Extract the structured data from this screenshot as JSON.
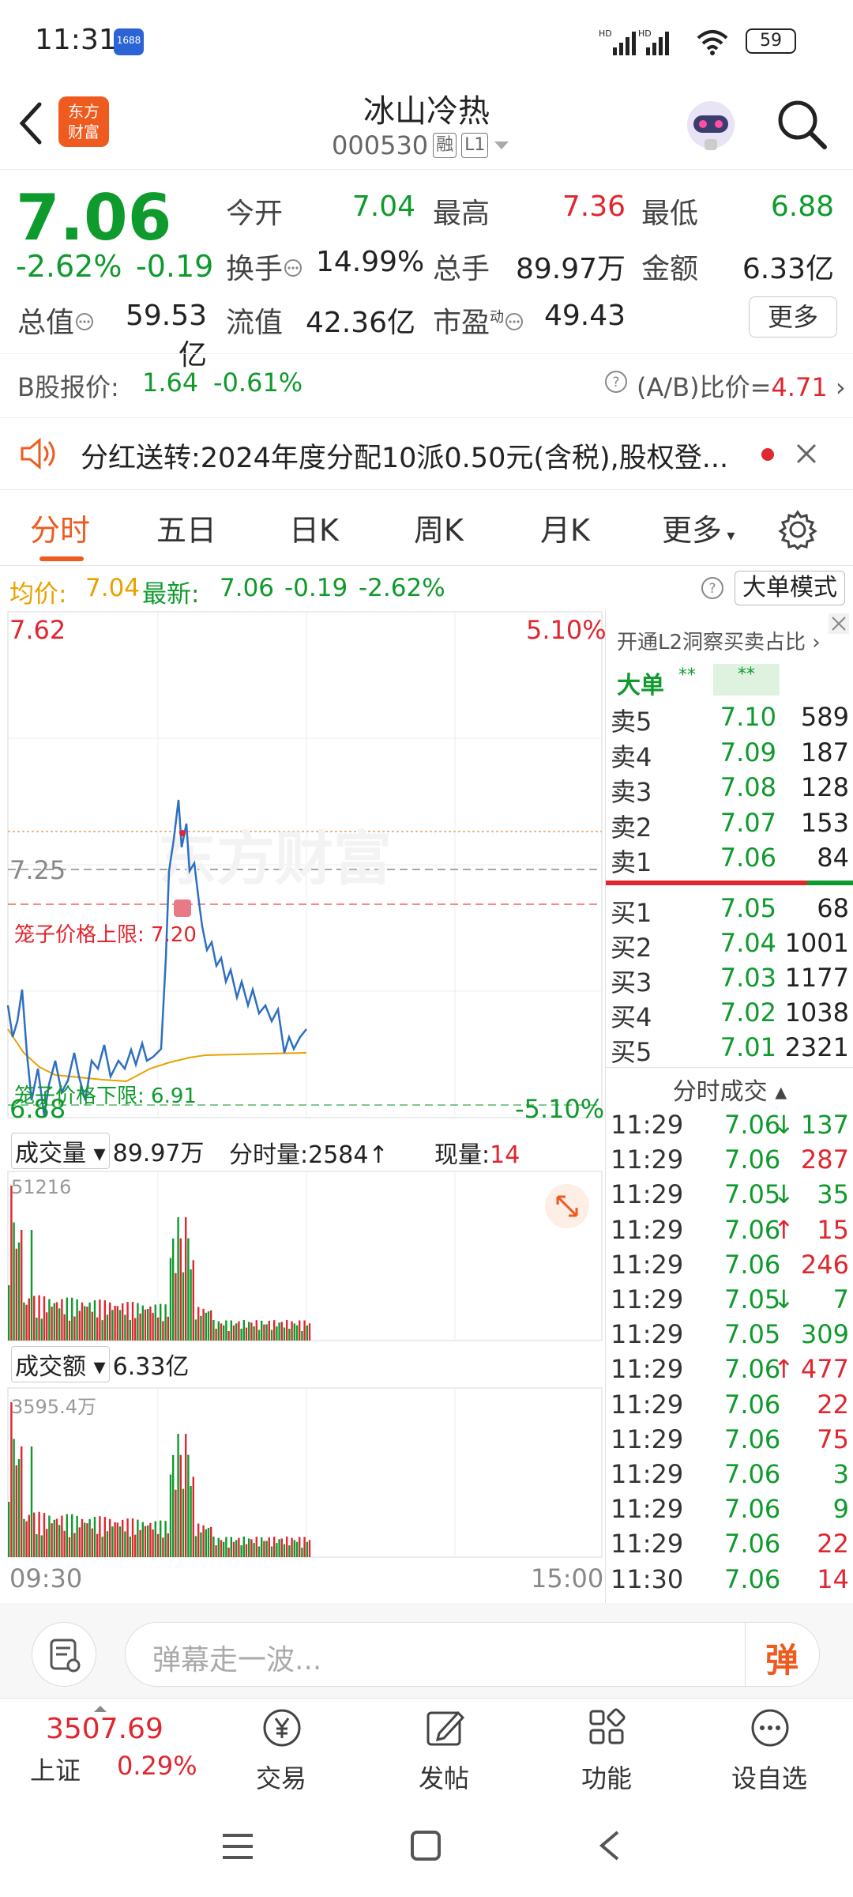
{
  "status_bar": {
    "time": "11:31",
    "badge": "1688",
    "battery": "59"
  },
  "header": {
    "logo_line1": "东方",
    "logo_line2": "财富",
    "title": "冰山冷热",
    "code": "000530",
    "tag_margin": "融",
    "tag_level": "L1"
  },
  "quote": {
    "price": "7.06",
    "change_pct": "-2.62%",
    "change": "-0.19",
    "open_label": "今开",
    "open": "7.04",
    "high_label": "最高",
    "high": "7.36",
    "low_label": "最低",
    "low": "6.88",
    "turnover_label": "换手",
    "turnover": "14.99%",
    "volume_label": "总手",
    "volume": "89.97万",
    "amount_label": "金额",
    "amount": "6.33亿",
    "mktcap_label": "总值",
    "mktcap": "59.53亿",
    "float_label": "流值",
    "float": "42.36亿",
    "pe_label": "市盈",
    "pe_sup": "动",
    "pe": "49.43",
    "more_button": "更多",
    "b_label": "B股报价:",
    "b_price": "1.64",
    "b_change": "-0.61%",
    "ab_label": "(A/B)比价=",
    "ab_value": "4.71"
  },
  "notice": {
    "text": "分红送转:2024年度分配10派0.50元(含税),股权登..."
  },
  "tabs": [
    "分时",
    "五日",
    "日K",
    "周K",
    "月K",
    "更多"
  ],
  "avg_bar": {
    "avg_label": "均价:",
    "avg": "7.04",
    "latest_label": "最新:",
    "latest": "7.06",
    "chg": "-0.19",
    "pct": "-2.62%",
    "mode_button": "大单模式"
  },
  "chart": {
    "top_price": "7.62",
    "top_pct": "5.10%",
    "bottom_price": "6.88",
    "bottom_pct": "-5.10%",
    "ref_price": "7.25",
    "upper_limit": "笼子价格上限: 7.20",
    "lower_limit": "笼子价格下限: 6.91",
    "watermark": "东方财富",
    "vol_label": "成交量",
    "vol_total": "89.97万",
    "tick_vol_label": "分时量:",
    "tick_vol": "2584",
    "cur_vol_label": "现量:",
    "cur_vol": "14",
    "vol_max": "51216",
    "amt_label": "成交额",
    "amt_total": "6.33亿",
    "amt_max": "3595.4万",
    "time_start": "09:30",
    "time_end": "15:00"
  },
  "order_book": {
    "l2_link": "开通L2洞察买卖占比",
    "big_label": "大单",
    "big_a": "**",
    "big_b": "**",
    "asks": [
      {
        "label": "卖5",
        "price": "7.10",
        "vol": "589"
      },
      {
        "label": "卖4",
        "price": "7.09",
        "vol": "187"
      },
      {
        "label": "卖3",
        "price": "7.08",
        "vol": "128"
      },
      {
        "label": "卖2",
        "price": "7.07",
        "vol": "153"
      },
      {
        "label": "卖1",
        "price": "7.06",
        "vol": "84"
      }
    ],
    "bids": [
      {
        "label": "买1",
        "price": "7.05",
        "vol": "68"
      },
      {
        "label": "买2",
        "price": "7.04",
        "vol": "1001"
      },
      {
        "label": "买3",
        "price": "7.03",
        "vol": "1177"
      },
      {
        "label": "买4",
        "price": "7.02",
        "vol": "1038"
      },
      {
        "label": "买5",
        "price": "7.01",
        "vol": "2321"
      }
    ],
    "trades_title": "分时成交",
    "trades": [
      {
        "t": "11:29",
        "p": "7.06",
        "d": "↓",
        "v": "137",
        "vc": "green",
        "pc": "green",
        "dc": "green"
      },
      {
        "t": "11:29",
        "p": "7.06",
        "d": "",
        "v": "287",
        "vc": "red",
        "pc": "green",
        "dc": ""
      },
      {
        "t": "11:29",
        "p": "7.05",
        "d": "↓",
        "v": "35",
        "vc": "green",
        "pc": "green",
        "dc": "green"
      },
      {
        "t": "11:29",
        "p": "7.06",
        "d": "↑",
        "v": "15",
        "vc": "red",
        "pc": "green",
        "dc": "red"
      },
      {
        "t": "11:29",
        "p": "7.06",
        "d": "",
        "v": "246",
        "vc": "red",
        "pc": "green",
        "dc": ""
      },
      {
        "t": "11:29",
        "p": "7.05",
        "d": "↓",
        "v": "7",
        "vc": "green",
        "pc": "green",
        "dc": "green"
      },
      {
        "t": "11:29",
        "p": "7.05",
        "d": "",
        "v": "309",
        "vc": "green",
        "pc": "green",
        "dc": ""
      },
      {
        "t": "11:29",
        "p": "7.06",
        "d": "↑",
        "v": "477",
        "vc": "red",
        "pc": "green",
        "dc": "red"
      },
      {
        "t": "11:29",
        "p": "7.06",
        "d": "",
        "v": "22",
        "vc": "red",
        "pc": "green",
        "dc": ""
      },
      {
        "t": "11:29",
        "p": "7.06",
        "d": "",
        "v": "75",
        "vc": "red",
        "pc": "green",
        "dc": ""
      },
      {
        "t": "11:29",
        "p": "7.06",
        "d": "",
        "v": "3",
        "vc": "green",
        "pc": "green",
        "dc": ""
      },
      {
        "t": "11:29",
        "p": "7.06",
        "d": "",
        "v": "9",
        "vc": "green",
        "pc": "green",
        "dc": ""
      },
      {
        "t": "11:29",
        "p": "7.06",
        "d": "",
        "v": "22",
        "vc": "red",
        "pc": "green",
        "dc": ""
      },
      {
        "t": "11:30",
        "p": "7.06",
        "d": "",
        "v": "14",
        "vc": "red",
        "pc": "green",
        "dc": ""
      }
    ]
  },
  "comment": {
    "placeholder": "弹幕走一波...",
    "danmu_button": "弹"
  },
  "bottom_nav": {
    "index_value": "3507.69",
    "index_name": "上证",
    "index_pct": "0.29%",
    "items": [
      "交易",
      "发帖",
      "功能",
      "设自选"
    ]
  },
  "colors": {
    "up": "#e0262f",
    "down": "#0f9a2d",
    "accent": "#ef5a1e",
    "avg_line": "#e8a200",
    "price_line": "#2e6fc0"
  }
}
